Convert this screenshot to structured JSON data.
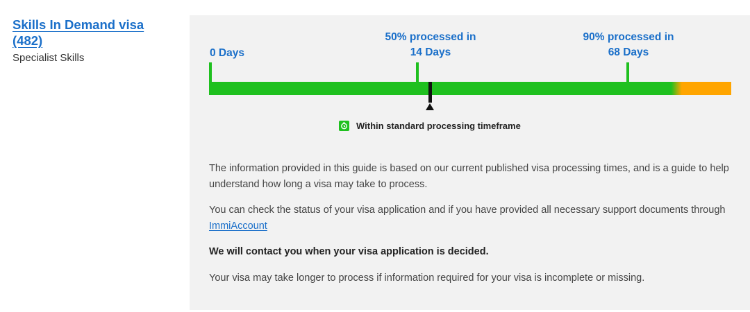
{
  "visa": {
    "title_line1": "Skills In Demand visa",
    "title_line2": "(482)",
    "subtitle": "Specialist Skills"
  },
  "timeline": {
    "start_label": "0 Days",
    "p50_line1": "50% processed in",
    "p50_line2": "14 Days",
    "p90_line1": "90% processed in",
    "p90_line2": "68 Days",
    "status_text": "Within standard processing timeframe",
    "status_icon": "clock-check-icon",
    "colors": {
      "within": "#1fc01f",
      "beyond": "#ffa500",
      "marker": "#111111",
      "label": "#1a6fc9"
    }
  },
  "info": {
    "paragraph1": "The information provided in this guide is based on our current published visa processing times, and is a guide to help understand how long a visa may take to process.",
    "paragraph2_before_link": "You can check the status of your visa application and if you have provided all necessary support documents through ",
    "paragraph2_link": "ImmiAccount",
    "paragraph3": "We will contact you when your visa application is decided.",
    "paragraph4": "Your visa may take longer to process if information required for your visa is incomplete or missing."
  }
}
